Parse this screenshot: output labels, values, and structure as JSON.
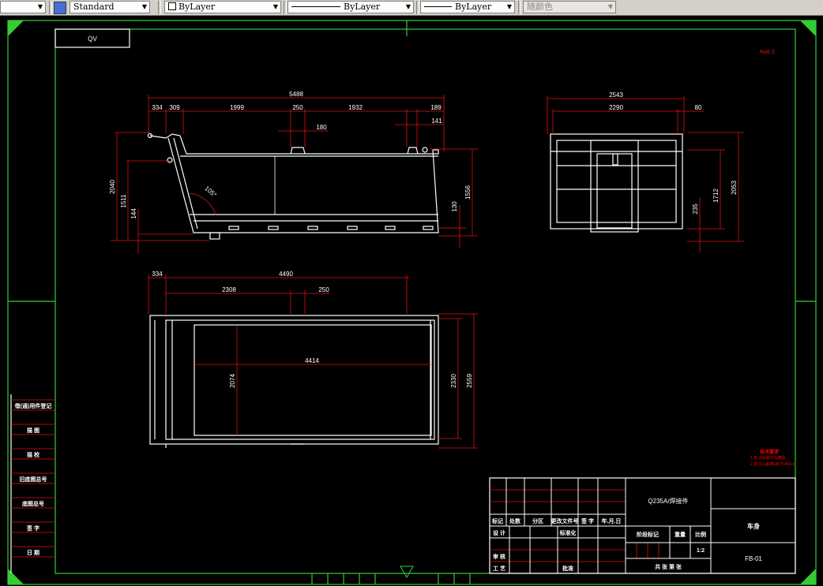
{
  "toolbar": {
    "textstyle": "Standard",
    "layer_color": "ByLayer",
    "linetype": "ByLayer",
    "lineweight": "ByLayer",
    "plotstyle": "随颜色"
  },
  "drawing": {
    "corner_label": "QV",
    "mark": "Ra6.3",
    "side_view_dims": [
      "5488",
      "334",
      "309",
      "1999",
      "250",
      "1932",
      "189",
      "180",
      "141",
      "2040",
      "1511",
      "144",
      "105°",
      "130",
      "1556"
    ],
    "end_view_dims": [
      "2543",
      "2290",
      "80",
      "235",
      "1712",
      "2053"
    ],
    "top_view_dims": [
      "334",
      "4490",
      "2308",
      "250",
      "4414",
      "2074",
      "2330",
      "2559"
    ],
    "notes": {
      "title": "技术要求",
      "line1": "1.未注焊缝均为满焊。",
      "line2": "2.未注公差按GB/T1804-m"
    },
    "side_table": [
      "借(通)用件登记",
      "描 图",
      "描 校",
      "旧底图总号",
      "底图总号",
      "签 字",
      "日 期"
    ],
    "title_block": {
      "material": "Q235A/焊接件",
      "name": "车身",
      "code": "FB-01",
      "headers": [
        "标记",
        "处数",
        "分区",
        "更改文件号",
        "签 字",
        "年.月.日"
      ],
      "design": "设 计",
      "standardization": "标准化",
      "review": "审 核",
      "process": "工 艺",
      "approve": "批准",
      "stage": "阶段标记",
      "weight": "重量",
      "scale_label": "比例",
      "scale": "1:2",
      "sheets": "共  张  第  张"
    }
  }
}
